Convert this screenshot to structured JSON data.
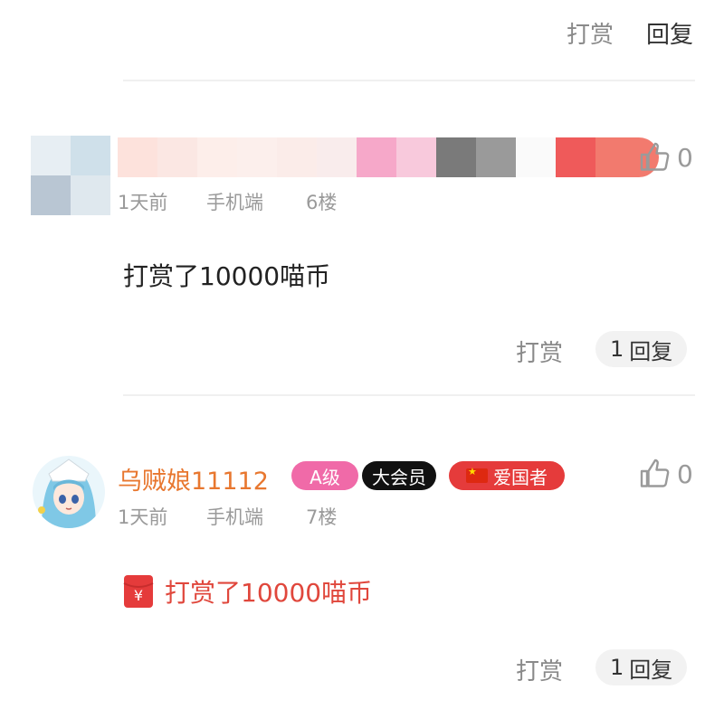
{
  "top": {
    "reward_label": "打赏",
    "reply_label": "回复"
  },
  "comment_6": {
    "time": "1天前",
    "device": "手机端",
    "floor": "6楼",
    "likes": "0",
    "text": "打赏了10000喵币",
    "reward_label": "打赏",
    "reply_count": "1",
    "reply_label": "回复"
  },
  "comment_7": {
    "username": "乌贼娘11112",
    "badges": {
      "level": "A级",
      "vip": "大会员",
      "patriot": "爱国者"
    },
    "time": "1天前",
    "device": "手机端",
    "floor": "7楼",
    "likes": "0",
    "text": "打赏了10000喵币",
    "reward_label": "打赏",
    "reply_count": "1",
    "reply_label": "回复"
  },
  "icons": [
    "thumbs-up-icon",
    "red-envelope-icon",
    "china-flag-icon"
  ],
  "colors": {
    "username": "#e8772f",
    "reward_text": "#e0473c",
    "badge_level": "#f06aa8",
    "badge_vip": "#111111",
    "badge_patriot": "#e53b3b"
  }
}
